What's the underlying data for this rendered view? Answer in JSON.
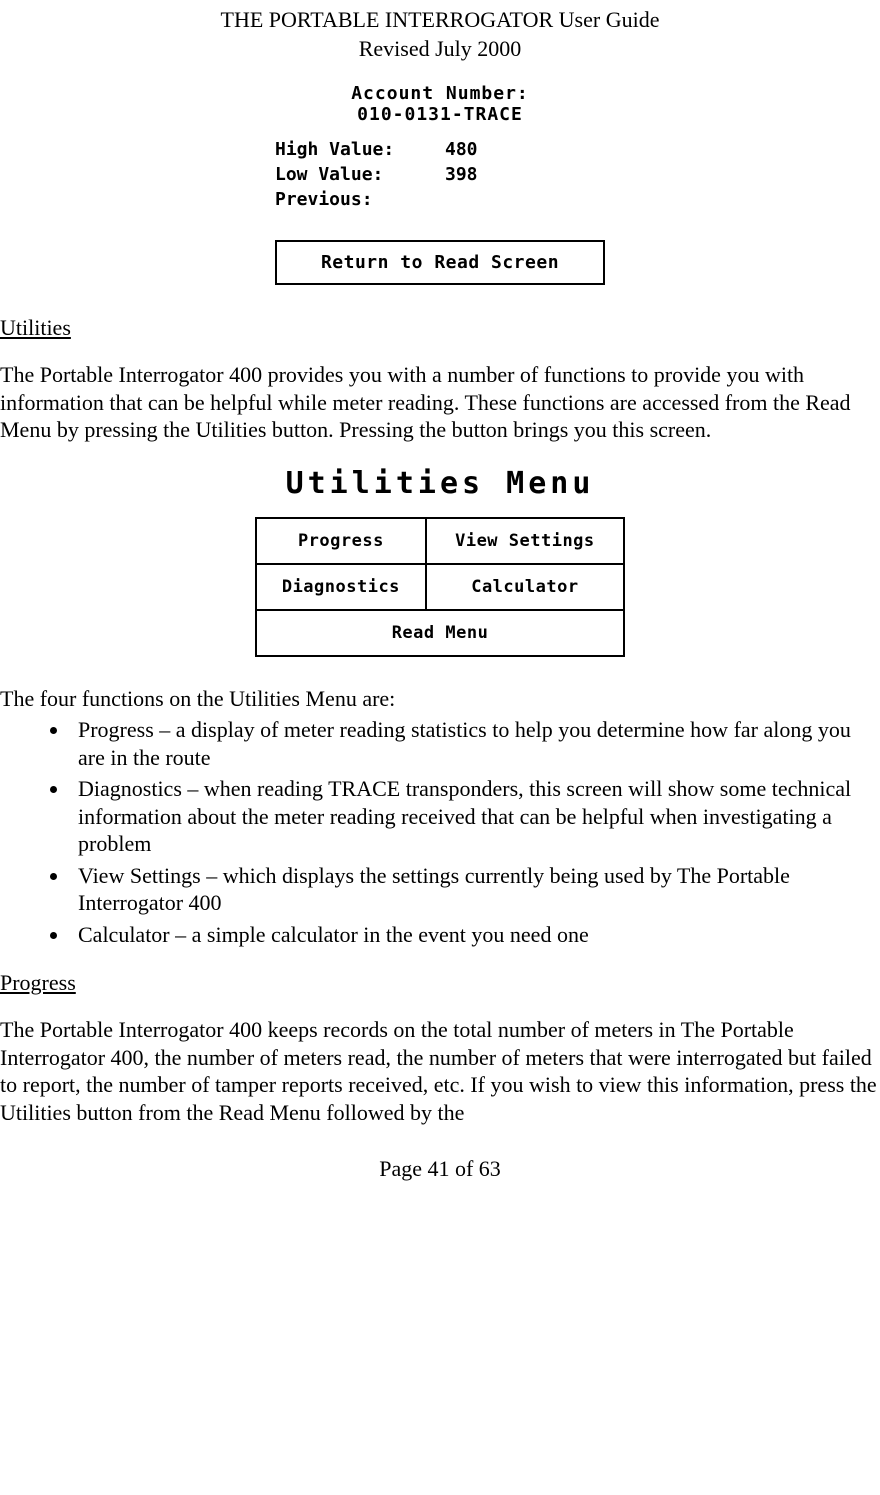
{
  "header": {
    "title": "THE PORTABLE INTERROGATOR User Guide",
    "revision": "Revised July 2000"
  },
  "screenshot1": {
    "account_label": "Account Number:",
    "account_value": "010-0131-TRACE",
    "high_label": "High Value:",
    "high_value": "480",
    "low_label": "Low Value:",
    "low_value": "398",
    "previous_label": "Previous:",
    "previous_value": "",
    "return_button": "Return to Read Screen"
  },
  "sections": {
    "utilities_heading": "Utilities",
    "utilities_para": "The Portable Interrogator 400 provides you with a number of functions to provide you with information that can be helpful while meter reading.  These functions are accessed from the Read Menu by pressing the Utilities button.  Pressing the button brings you this screen.",
    "functions_intro": "The four functions on the Utilities Menu are:",
    "bullets": [
      "Progress – a display of meter reading statistics to help you determine how far along you are in the route",
      "Diagnostics – when reading TRACE transponders, this screen will show some technical information about the meter reading received that can be helpful when investigating a problem",
      "View Settings – which displays the settings currently being used by The Portable Interrogator 400",
      "Calculator – a simple calculator in the event you need one"
    ],
    "progress_heading": "Progress",
    "progress_para": "The Portable Interrogator 400 keeps records on the total number of meters in The Portable Interrogator 400, the number of meters read, the number of meters that were interrogated but failed to report, the number of tamper reports received, etc.  If you wish to view this information, press the Utilities button from the Read Menu followed by the"
  },
  "screenshot2": {
    "title": "Utilities Menu",
    "buttons": {
      "progress": "Progress",
      "view_settings": "View Settings",
      "diagnostics": "Diagnostics",
      "calculator": "Calculator",
      "read_menu": "Read Menu"
    }
  },
  "footer": {
    "page": "Page 41 of 63"
  }
}
